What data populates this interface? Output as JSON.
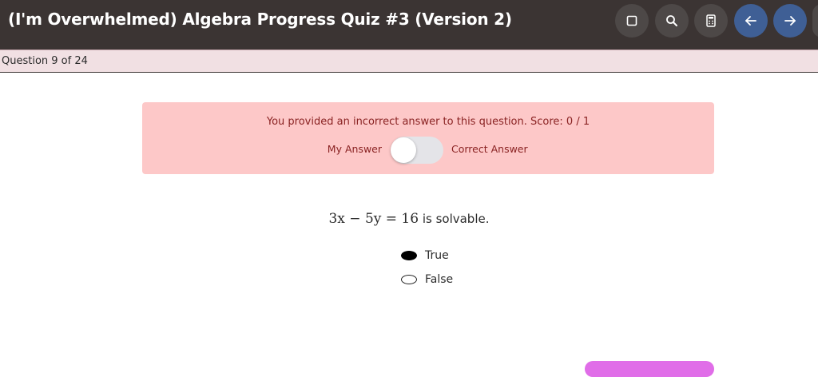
{
  "header": {
    "title": "(I'm Overwhelmed) Algebra Progress Quiz #3 (Version 2)",
    "buttons": [
      {
        "icon": "square-icon"
      },
      {
        "icon": "search-icon"
      },
      {
        "icon": "calculator-icon"
      },
      {
        "icon": "arrow-left-icon"
      },
      {
        "icon": "arrow-right-icon"
      }
    ]
  },
  "question_bar": {
    "counter": "Question 9 of 24"
  },
  "feedback": {
    "message": "You provided an incorrect answer to this question. Score: 0 / 1",
    "toggle_left_label": "My Answer",
    "toggle_right_label": "Correct Answer",
    "toggle_state": "My Answer"
  },
  "question": {
    "equation": "3x − 5y = 16",
    "text": "is solvable."
  },
  "options": [
    {
      "label": "True",
      "selected": true
    },
    {
      "label": "False",
      "selected": false
    }
  ],
  "colors": {
    "header_bg": "#3b3433",
    "nav_blue": "#3f5f95",
    "feedback_bg": "#fdc8c8",
    "feedback_text": "#8a2323",
    "question_bar_bg": "#f1e0e3",
    "accent_purple": "#e06de8"
  }
}
